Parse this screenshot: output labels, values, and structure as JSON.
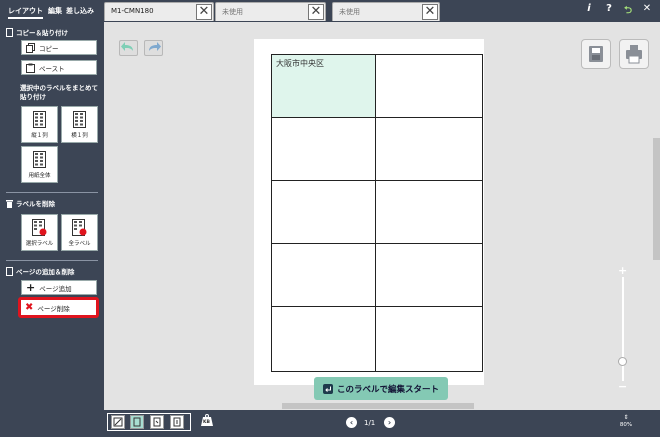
{
  "header": {
    "tabs": [
      "レイアウト",
      "編集",
      "差し込み"
    ],
    "documents": [
      {
        "label": "M1-CMN180",
        "close": "✕"
      },
      {
        "label": "未使用",
        "close": "✕"
      },
      {
        "label": "未使用",
        "close": "✕"
      }
    ],
    "info_label": "i",
    "help_label": "?",
    "back_label": "⮌",
    "close_label": "✕"
  },
  "sidebar": {
    "copy_section": {
      "title": "コピー＆貼り付け",
      "copy_label": "コピー",
      "paste_label": "ペースト"
    },
    "bulk_section": {
      "title": "選択中のラベルをまとめて貼り付け",
      "vertical_label": "縦１列",
      "horizontal_label": "横１列",
      "whole_label": "用紙全体"
    },
    "delete_section": {
      "title": "ラベルを削除",
      "selected_label": "選択ラベル",
      "all_label": "全ラベル"
    },
    "page_section": {
      "title": "ページの追加＆削除",
      "add_label": "ページ追加",
      "delete_label": "ページ削除"
    }
  },
  "canvas": {
    "first_cell_text": "大阪市中央区",
    "start_button_label": "このラベルで編集スタート",
    "zoom_plus": "+",
    "zoom_minus": "−"
  },
  "footer": {
    "page_indicator": "1/1",
    "zoom_level": "80%",
    "kb_label": "KB"
  },
  "colors": {
    "chrome": "#3c4555",
    "selected_cell": "#dff5ec",
    "start_button": "#84c9b4",
    "highlight_border": "#e0141e"
  }
}
